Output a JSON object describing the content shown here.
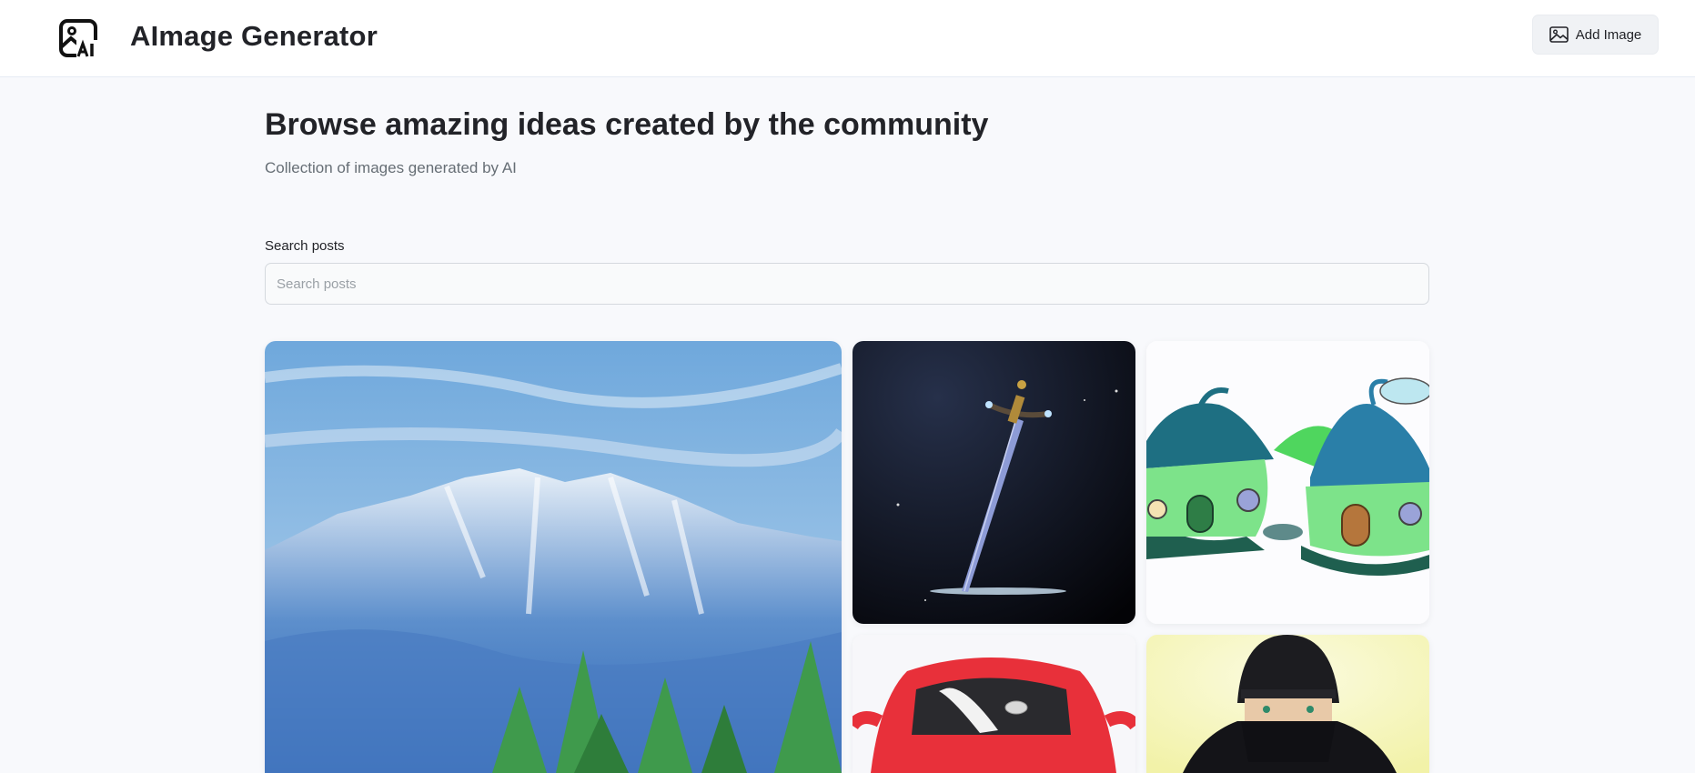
{
  "header": {
    "logo_icon": "ai-image-icon",
    "title": "AImage Generator",
    "add_button_label": "Add Image",
    "add_button_icon": "image-icon"
  },
  "hero": {
    "title": "Browse amazing ideas created by the community",
    "subtitle": "Collection of images generated by AI"
  },
  "search": {
    "label": "Search posts",
    "placeholder": "Search posts",
    "value": ""
  },
  "gallery": {
    "posts": [
      {
        "subject": "mountain landscape"
      },
      {
        "subject": "sword"
      },
      {
        "subject": "mushroom houses"
      },
      {
        "subject": "red car"
      },
      {
        "subject": "ninja"
      }
    ]
  },
  "colors": {
    "page_bg": "#f8f9fc",
    "header_bg": "#ffffff",
    "text_primary": "#222328",
    "text_secondary": "#666e75"
  }
}
